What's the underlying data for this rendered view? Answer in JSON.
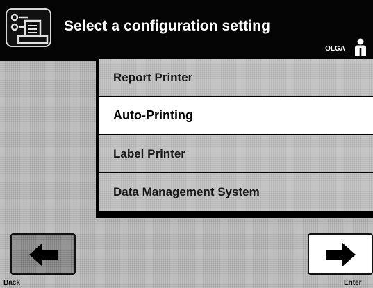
{
  "header": {
    "title": "Select a configuration setting",
    "user": "OLGA",
    "icon": "printer-settings-icon",
    "user_icon": "user-icon"
  },
  "menu": {
    "items": [
      {
        "label": "Report Printer",
        "selected": false
      },
      {
        "label": "Auto-Printing",
        "selected": true
      },
      {
        "label": "Label Printer",
        "selected": false
      },
      {
        "label": "Data Management System",
        "selected": false
      }
    ]
  },
  "nav": {
    "back_label": "Back",
    "enter_label": "Enter",
    "back_icon": "arrow-left-icon",
    "enter_icon": "arrow-right-icon"
  },
  "colors": {
    "header_bg": "#050505",
    "selected_bg": "#ffffff",
    "panel_border": "#000000"
  }
}
